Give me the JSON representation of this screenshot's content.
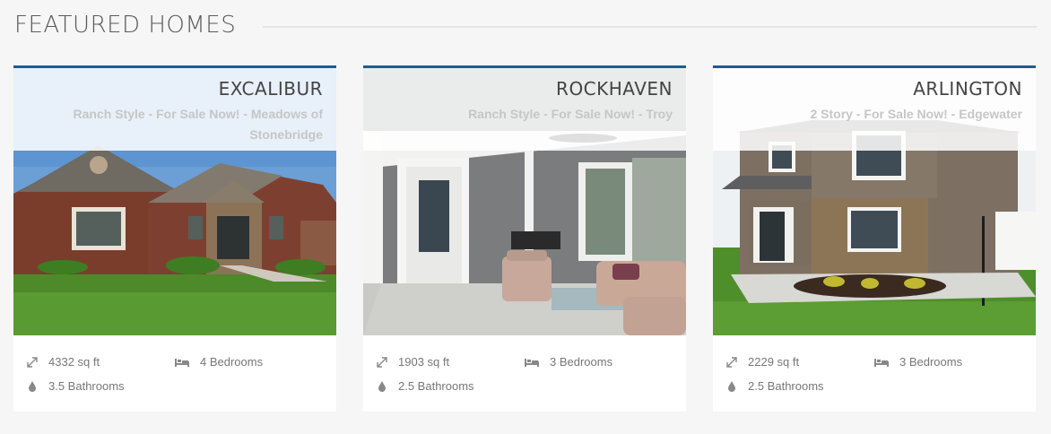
{
  "section": {
    "title": "FEATURED HOMES"
  },
  "theme": {
    "accent": "#1f5b96"
  },
  "homes": [
    {
      "name": "EXCALIBUR",
      "description": "Ranch Style - For Sale Now! - Meadows of Stonebridge",
      "sqft": "4332 sq ft",
      "bedrooms": "4 Bedrooms",
      "bathrooms": "3.5 Bathrooms",
      "photo": "brick-ranch-house-photo"
    },
    {
      "name": "ROCKHAVEN",
      "description": "Ranch Style - For Sale Now! - Troy",
      "sqft": "1903 sq ft",
      "bedrooms": "3 Bedrooms",
      "bathrooms": "2.5 Bathrooms",
      "photo": "covered-patio-photo"
    },
    {
      "name": "ARLINGTON",
      "description": "2 Story - For Sale Now! - Edgewater",
      "sqft": "2229 sq ft",
      "bedrooms": "3 Bedrooms",
      "bathrooms": "2.5 Bathrooms",
      "photo": "two-story-house-photo"
    }
  ],
  "icons": {
    "area": "expand-arrows-icon",
    "bed": "bed-icon",
    "bath": "water-drop-icon"
  }
}
